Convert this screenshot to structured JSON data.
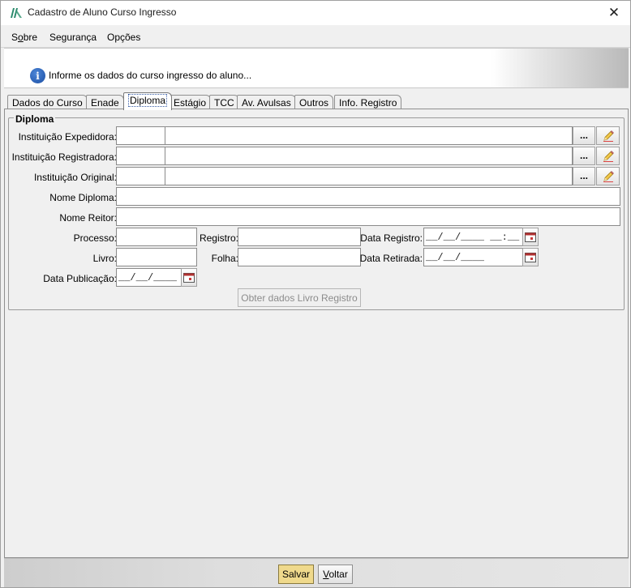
{
  "window": {
    "title": "Cadastro de Aluno Curso Ingresso",
    "close_glyph": "✕"
  },
  "menu": [
    {
      "label": "Sobre",
      "mnemonic": "o"
    },
    {
      "label": "Segurança"
    },
    {
      "label": "Opções"
    }
  ],
  "info": {
    "icon": "info-icon",
    "glyph": "i",
    "text": "Informe os dados do curso ingresso do aluno..."
  },
  "tabs": [
    "Dados do Curso",
    "Enade",
    "Diploma",
    "Estágio",
    "TCC",
    "Av. Avulsas",
    "Outros",
    "Info. Registro"
  ],
  "active_tab": "Diploma",
  "group": {
    "title": "Diploma",
    "labels": {
      "inst_expedidora": "Instituição Expedidora:",
      "inst_registradora": "Instituição Registradora:",
      "inst_original": "Instituição Original:",
      "nome_diploma": "Nome Diploma:",
      "nome_reitor": "Nome Reitor:",
      "processo": "Processo:",
      "registro": "Registro:",
      "data_registro": "Data Registro:",
      "livro": "Livro:",
      "folha": "Folha:",
      "data_retirada": "Data Retirada:",
      "data_publicacao": "Data Publicação:"
    },
    "values": {
      "data_registro": "__/__/____ __:__",
      "data_retirada": "__/__/____",
      "data_publicacao": "__/__/____"
    },
    "lookup_button": "...",
    "obter_button": "Obter dados Livro Registro"
  },
  "footer": {
    "save": {
      "label": "Salvar"
    },
    "back": {
      "label": "Voltar",
      "mnemonic": "V"
    }
  },
  "colors": {
    "primary_button": "#efd98c",
    "info_icon": "#1c4fa3",
    "accent": "#3a5fa8"
  }
}
